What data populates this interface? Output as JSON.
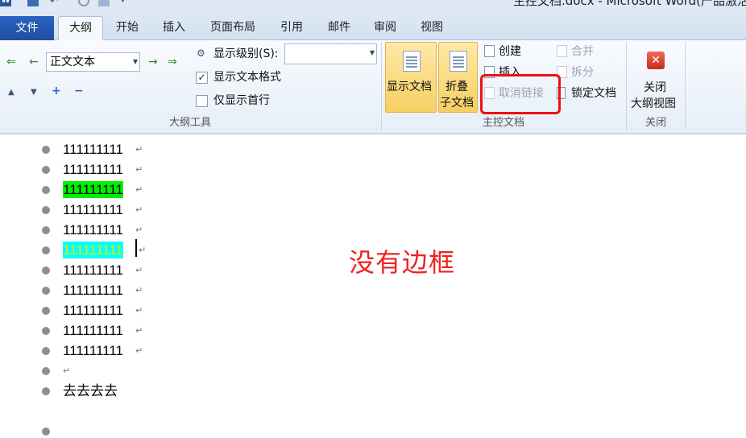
{
  "window": {
    "title": "主控文档.docx - Microsoft Word(产品激活"
  },
  "tabs": {
    "file": "文件",
    "items": [
      "大纲",
      "开始",
      "插入",
      "页面布局",
      "引用",
      "邮件",
      "审阅",
      "视图"
    ],
    "active": "大纲"
  },
  "outline_tools": {
    "group_label": "大纲工具",
    "level_value": "正文文本",
    "show_level_label": "显示级别(S):",
    "show_level_value": "",
    "show_text_format_label": "显示文本格式",
    "show_text_format_checked": true,
    "show_first_line_label": "仅显示首行",
    "show_first_line_checked": false
  },
  "master_document": {
    "group_label": "主控文档",
    "show_document": "显示文档",
    "collapse_line1": "折叠",
    "collapse_line2": "子文档",
    "create": "创建",
    "insert": "插入",
    "unlink": "取消链接",
    "merge": "合并",
    "split": "拆分",
    "lock_document": "锁定文档"
  },
  "close_group": {
    "group_label": "关闭",
    "close_line1": "关闭",
    "close_line2": "大纲视图"
  },
  "document": {
    "lines": [
      {
        "text": "111111111",
        "highlight": "none"
      },
      {
        "text": "111111111",
        "highlight": "none"
      },
      {
        "text": "111111111",
        "highlight": "green"
      },
      {
        "text": "111111111",
        "highlight": "none"
      },
      {
        "text": "111111111",
        "highlight": "none"
      },
      {
        "text": "111111111",
        "highlight": "cyan"
      },
      {
        "text": "111111111",
        "highlight": "none"
      },
      {
        "text": "111111111",
        "highlight": "none"
      },
      {
        "text": "111111111",
        "highlight": "none"
      },
      {
        "text": "111111111",
        "highlight": "none"
      },
      {
        "text": "111111111",
        "highlight": "none"
      },
      {
        "text": "",
        "highlight": "none"
      },
      {
        "text": "去去去去",
        "highlight": "none"
      },
      {
        "text": "",
        "highlight": "none"
      }
    ],
    "paragraph_mark": "↵",
    "annotation": "没有边框"
  },
  "colors": {
    "file_tab": "#2a63c4",
    "highlight_green": "#00ee00",
    "highlight_cyan": "#00ffff",
    "annotation_red": "#ee2222"
  }
}
